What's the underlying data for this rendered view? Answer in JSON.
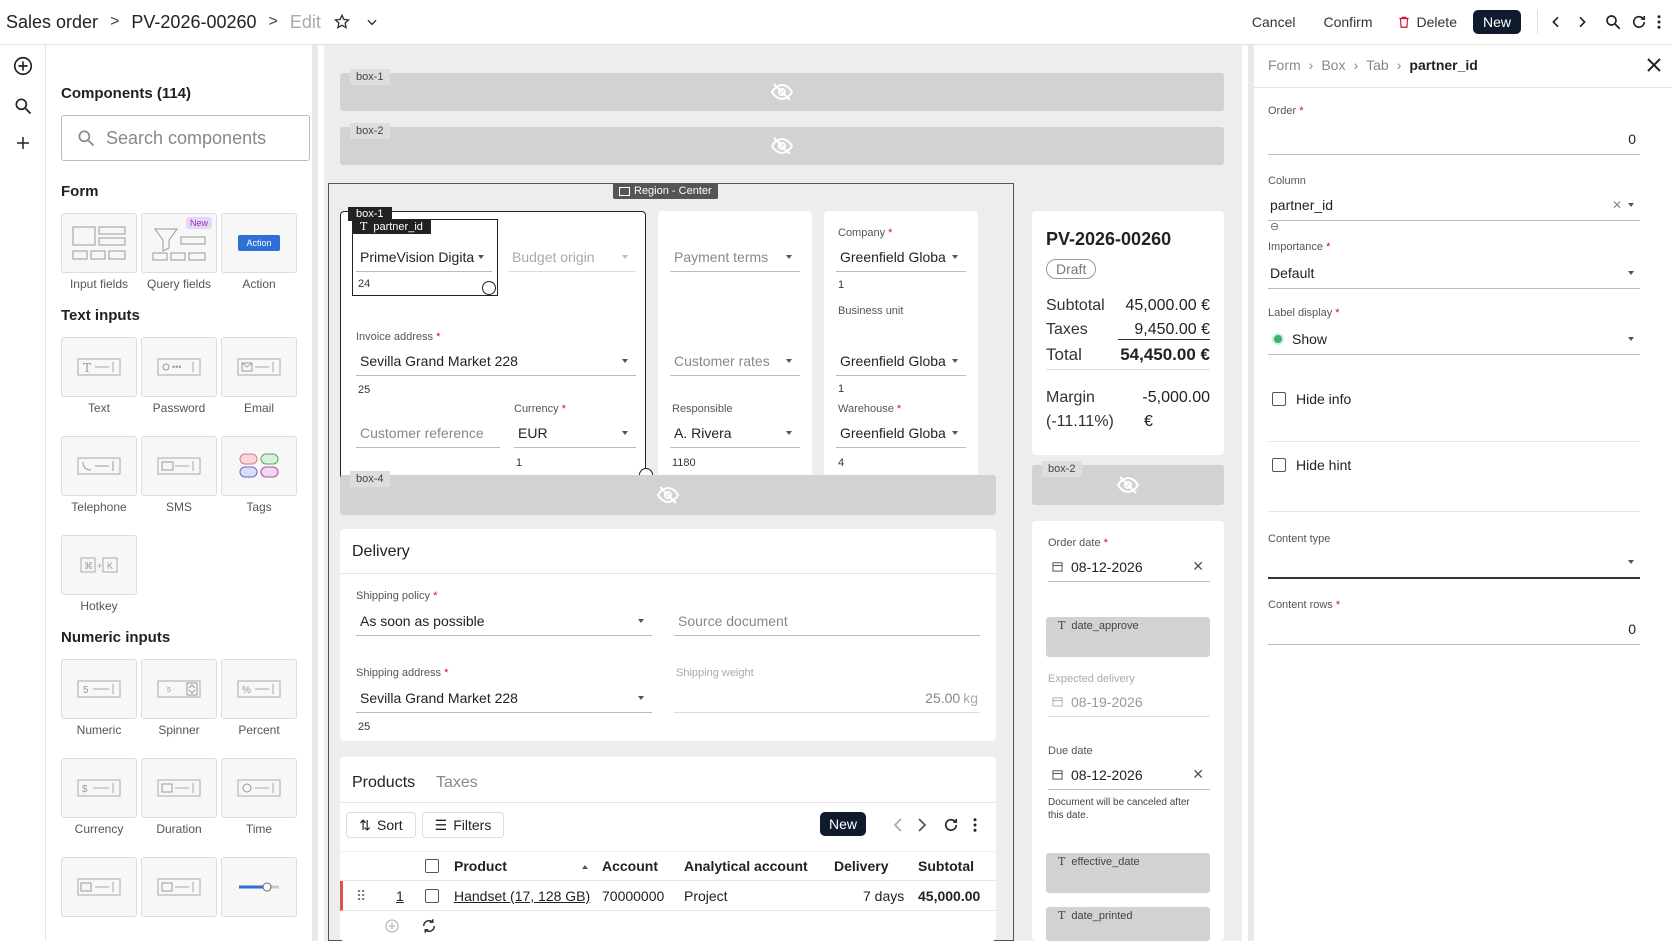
{
  "header": {
    "crumb1": "Sales order",
    "crumb2": "PV-2026-00260",
    "edit": "Edit",
    "cancel": "Cancel",
    "confirm": "Confirm",
    "delete": "Delete",
    "new": "New"
  },
  "components": {
    "title": "Components (114)",
    "search_placeholder": "Search components",
    "sections": {
      "form": "Form",
      "text": "Text inputs",
      "numeric": "Numeric inputs"
    },
    "form_items": [
      "Input fields",
      "Query fields",
      "Action"
    ],
    "new_tag": "New",
    "action_tile": "Action",
    "text_items": [
      "Text",
      "Password",
      "Email",
      "Telephone",
      "SMS",
      "Tags",
      "Hotkey"
    ],
    "numeric_items": [
      "Numeric",
      "Spinner",
      "Percent",
      "Currency",
      "Duration",
      "Time"
    ]
  },
  "canvas": {
    "box1": "box-1",
    "box2": "box-2",
    "box4": "box-4",
    "region": "Region - Center",
    "partner_tag": "partner_id",
    "partner_value": "PrimeVision Digita",
    "partner_hint": "24",
    "budget_ph": "Budget origin",
    "invoice_label": "Invoice address",
    "invoice_value": "Sevilla Grand Market 228",
    "invoice_hint": "25",
    "currency_label": "Currency",
    "currency_value": "EUR",
    "currency_hint": "1",
    "custref_ph": "Customer reference",
    "payment_ph": "Payment terms",
    "custrates_ph": "Customer rates",
    "responsible_label": "Responsible",
    "responsible_value": "A. Rivera",
    "responsible_hint": "1180",
    "company_label": "Company",
    "company_value": "Greenfield Globa",
    "company_hint": "1",
    "bu_label": "Business unit",
    "bu_value": "Greenfield Globa",
    "bu_hint": "1",
    "warehouse_label": "Warehouse",
    "warehouse_value": "Greenfield Globa",
    "warehouse_hint": "4",
    "delivery": {
      "title": "Delivery",
      "policy_label": "Shipping policy",
      "policy_value": "As soon as possible",
      "source_ph": "Source document",
      "addr_label": "Shipping address",
      "addr_value": "Sevilla Grand Market 228",
      "addr_hint": "25",
      "weight_label": "Shipping weight",
      "weight_value": "25.00",
      "weight_unit": "kg"
    },
    "products": {
      "tab1": "Products",
      "tab2": "Taxes",
      "sort": "Sort",
      "filters": "Filters",
      "new": "New",
      "cols": [
        "Product",
        "Account",
        "Analytical account",
        "Delivery",
        "Subtotal"
      ],
      "row": {
        "num": "1",
        "product": "Handset (17, 128 GB)",
        "account": "70000000",
        "analytic": "Project",
        "delivery": "7 days",
        "subtotal": "45,000.00"
      }
    }
  },
  "summary": {
    "title": "PV-2026-00260",
    "status": "Draft",
    "subtotal_label": "Subtotal",
    "subtotal": "45,000.00 €",
    "taxes_label": "Taxes",
    "taxes": "9,450.00 €",
    "total_label": "Total",
    "total": "54,450.00 €",
    "margin_label": "Margin",
    "margin_pct": "(-11.11%)",
    "margin": "-5,000.00",
    "margin_cur": "€",
    "box2": "box-2",
    "order_date_label": "Order date",
    "order_date": "08-12-2026",
    "date_approve": "date_approve",
    "expected_label": "Expected delivery",
    "expected": "08-19-2026",
    "due_label": "Due date",
    "due": "08-12-2026",
    "due_hint": "Document will be canceled after this date.",
    "effective": "effective_date",
    "printed": "date_printed"
  },
  "props": {
    "crumbs": [
      "Form",
      "Box",
      "Tab",
      "partner_id"
    ],
    "order_label": "Order",
    "order_value": "0",
    "column_label": "Column",
    "column_value": "partner_id",
    "importance_label": "Importance",
    "importance_value": "Default",
    "label_display_label": "Label display",
    "label_display_value": "Show",
    "hide_info": "Hide info",
    "hide_hint": "Hide hint",
    "content_type_label": "Content type",
    "content_rows_label": "Content rows",
    "content_rows_value": "0"
  },
  "colors": {
    "accent": "#0f1b2d",
    "required": "#d01030",
    "action_blue": "#2f6fd8"
  }
}
